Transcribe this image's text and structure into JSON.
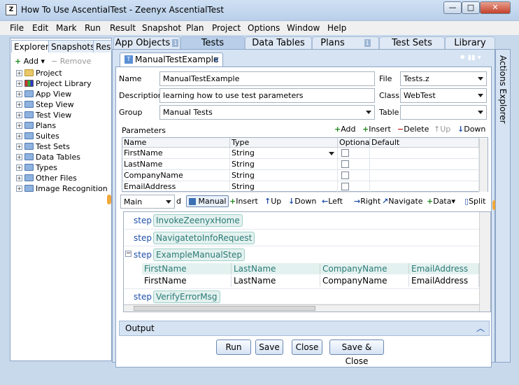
{
  "window": {
    "title": "How To Use AscentialTest - Zeenyx AscentialTest",
    "icon": "Z",
    "minimize": "—",
    "maximize": "□",
    "close": "✕"
  },
  "menu": [
    "File",
    "Edit",
    "Mark",
    "Run",
    "Result",
    "Snapshot",
    "Plan",
    "Project",
    "Options",
    "Window",
    "Help"
  ],
  "left_panel": {
    "tabs": [
      "Explorer",
      "Snapshots",
      "Res"
    ],
    "add_label": "Add",
    "remove_label": "Remove",
    "tree": [
      "Project",
      "Project Library",
      "App View",
      "Step View",
      "Test View",
      "Plans",
      "Suites",
      "Test Sets",
      "Data Tables",
      "Types",
      "Other Files",
      "Image Recognition"
    ]
  },
  "top_tabs": [
    {
      "label": "App Objects",
      "num": "1"
    },
    {
      "label": "Tests"
    },
    {
      "label": "Data Tables"
    },
    {
      "label": "Plans",
      "num": "1"
    },
    {
      "label": "Test Sets"
    },
    {
      "label": "Library"
    }
  ],
  "doc_tab": {
    "label": "ManualTestExample",
    "close": "×",
    "icon": "T"
  },
  "form": {
    "name_label": "Name",
    "name_value": "ManualTestExample",
    "desc_label": "Description",
    "desc_value": "learning how to use test parameters",
    "group_label": "Group",
    "group_value": "Manual Tests",
    "file_label": "File",
    "file_value": "Tests.z",
    "class_label": "Class",
    "class_value": "WebTest",
    "table_label": "Table",
    "table_value": ""
  },
  "params": {
    "label": "Parameters",
    "toolbar": {
      "add": "Add",
      "insert": "Insert",
      "delete": "Delete",
      "up": "Up",
      "down": "Down"
    },
    "columns": [
      "Name",
      "Type",
      "Optional",
      "Default"
    ],
    "rows": [
      {
        "name": "FirstName",
        "type": "String"
      },
      {
        "name": "LastName",
        "type": "String"
      },
      {
        "name": "CompanyName",
        "type": "String"
      },
      {
        "name": "EmailAddress",
        "type": "String"
      }
    ]
  },
  "steps_toolbar": {
    "context": "Main",
    "context_suffix": "d",
    "manual": "Manual",
    "insert": "Insert",
    "up": "Up",
    "down": "Down",
    "left": "Left",
    "right": "Right",
    "navigate": "Navigate",
    "data": "Data",
    "split": "Split"
  },
  "steps": {
    "keyword": "step",
    "items": [
      "InvokeZeenyxHome",
      "NavigatetoInfoRequest",
      "ExampleManualStep",
      "VerifyErrorMsg"
    ],
    "data_columns": [
      "FirstName",
      "LastName",
      "CompanyName",
      "EmailAddress"
    ],
    "data_row": [
      "FirstName",
      "LastName",
      "CompanyName",
      "EmailAddress"
    ],
    "collapse": "−"
  },
  "output": {
    "label": "Output"
  },
  "buttons": {
    "run": "Run",
    "save": "Save",
    "close": "Close",
    "save_close": "Save & Close"
  },
  "right_panel": {
    "label": "Actions Explorer"
  }
}
